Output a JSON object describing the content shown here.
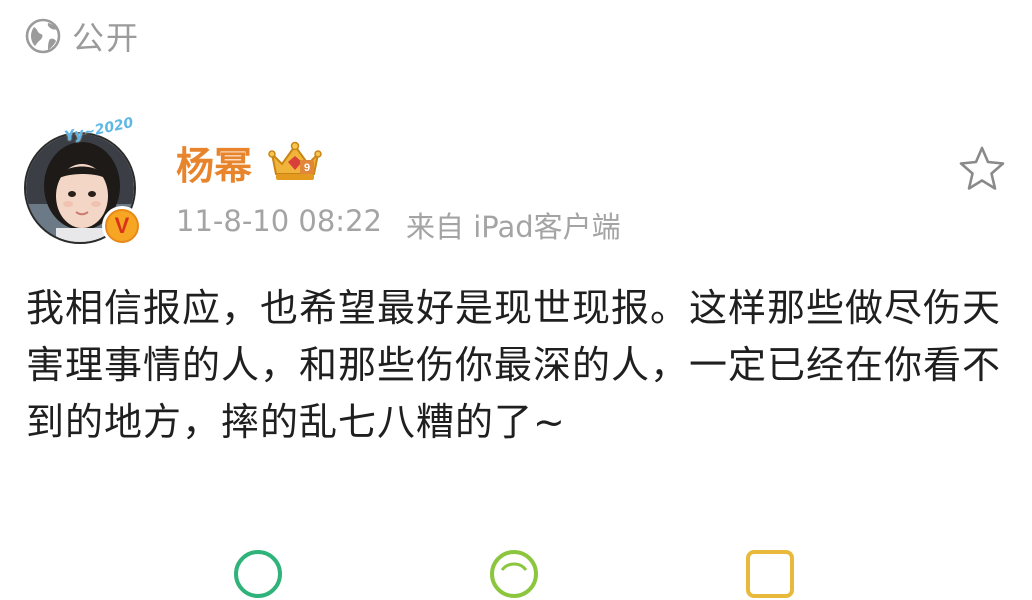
{
  "visibility": {
    "icon": "globe-icon",
    "label": "公开"
  },
  "post": {
    "author": {
      "name": "杨幂",
      "avatar_tag": "Yy~2020",
      "verified_icon": "verified-badge-icon",
      "verified_mark": "V",
      "crown_icon": "crown-badge-icon"
    },
    "timestamp": "11-8-10 08:22",
    "source": "来自 iPad客户端",
    "favorite_icon": "star-icon",
    "content": "我相信报应，也希望最好是现世现报。这样那些做尽伤天害理事情的人，和那些伤你最深的人，一定已经在你看不到的地方，摔的乱七八糟的了~"
  },
  "actions": [
    {
      "icon": "repost-icon"
    },
    {
      "icon": "comment-icon"
    },
    {
      "icon": "like-icon"
    }
  ],
  "colors": {
    "username": "#e8842b",
    "meta_text": "#a4a4a4",
    "body_text": "#1f1f1f",
    "verified_badge": "#f6a623",
    "visibility_text": "#9b9b9b"
  }
}
